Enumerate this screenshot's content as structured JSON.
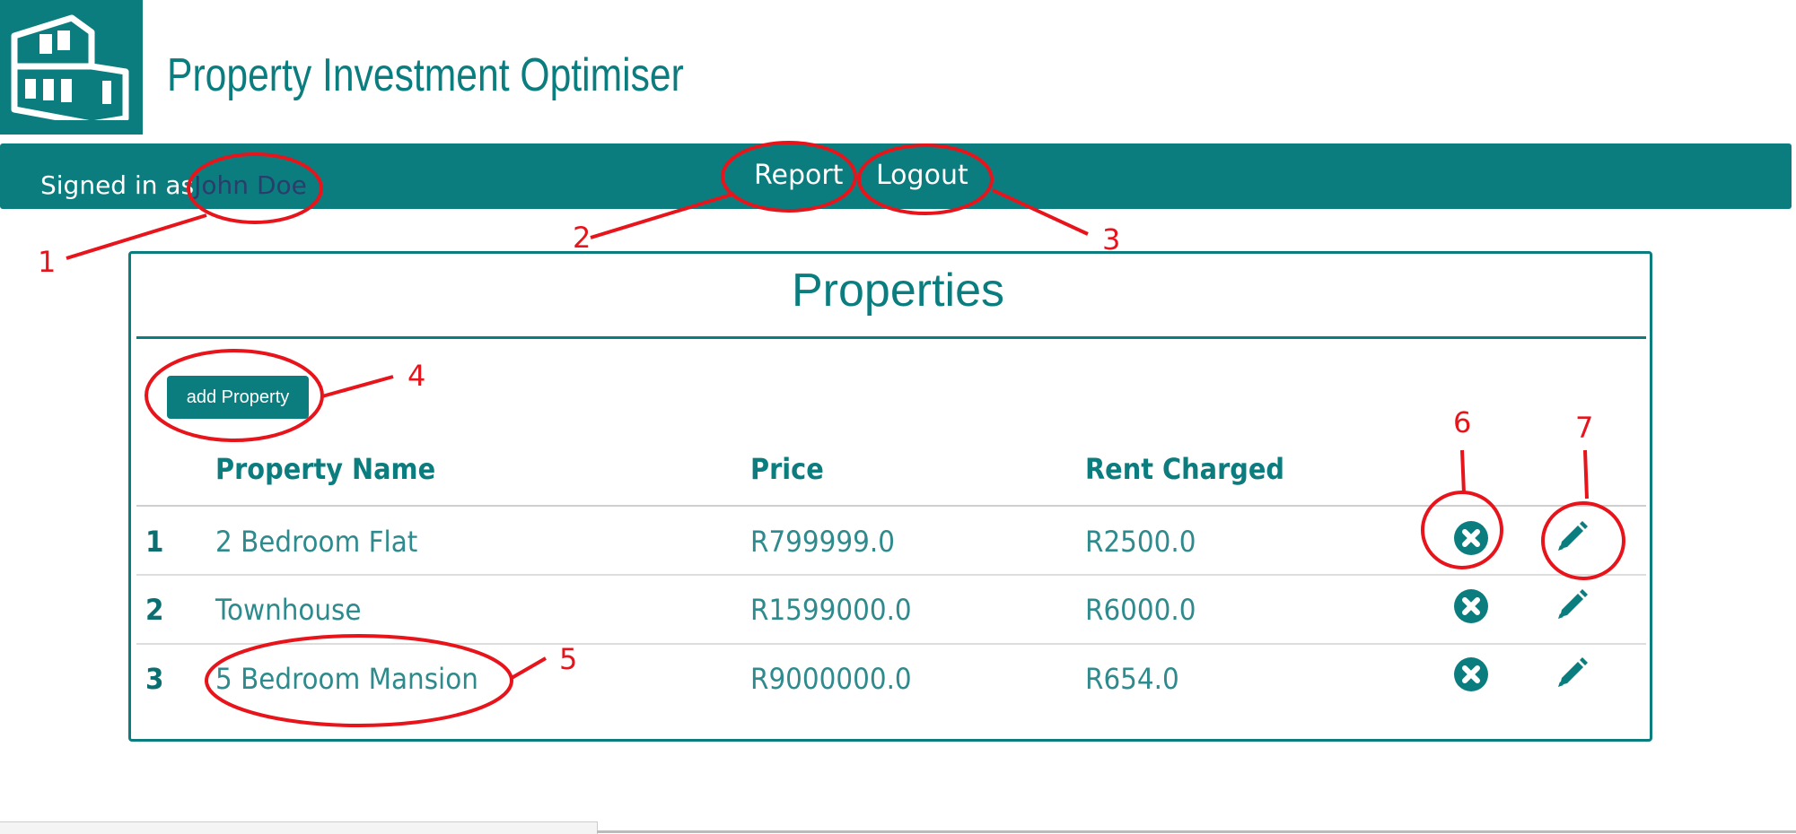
{
  "header": {
    "app_title": "Property Investment Optimiser",
    "logo_icon": "house-logo-icon"
  },
  "navbar": {
    "signed_in_label": "Signed in as",
    "user_name": "John Doe",
    "report_label": "Report",
    "logout_label": "Logout"
  },
  "panel": {
    "title": "Properties",
    "add_button_label": "add Property",
    "columns": {
      "name": "Property Name",
      "price": "Price",
      "rent": "Rent Charged"
    },
    "rows": [
      {
        "index": "1",
        "name": "2 Bedroom Flat",
        "price": "R799999.0",
        "rent": "R2500.0"
      },
      {
        "index": "2",
        "name": "Townhouse",
        "price": "R1599000.0",
        "rent": "R6000.0"
      },
      {
        "index": "3",
        "name": "5 Bedroom Mansion",
        "price": "R9000000.0",
        "rent": "R654.0"
      }
    ],
    "row_actions": [
      "delete-icon",
      "edit-pencil-icon"
    ]
  },
  "annotations": {
    "color": "#e8141b",
    "labels": [
      "1",
      "2",
      "3",
      "4",
      "5",
      "6",
      "7"
    ]
  },
  "theme": {
    "primary": "#0b7d7f",
    "text_teal": "#2e8a8c",
    "user_name_color": "#2a3d6b"
  }
}
